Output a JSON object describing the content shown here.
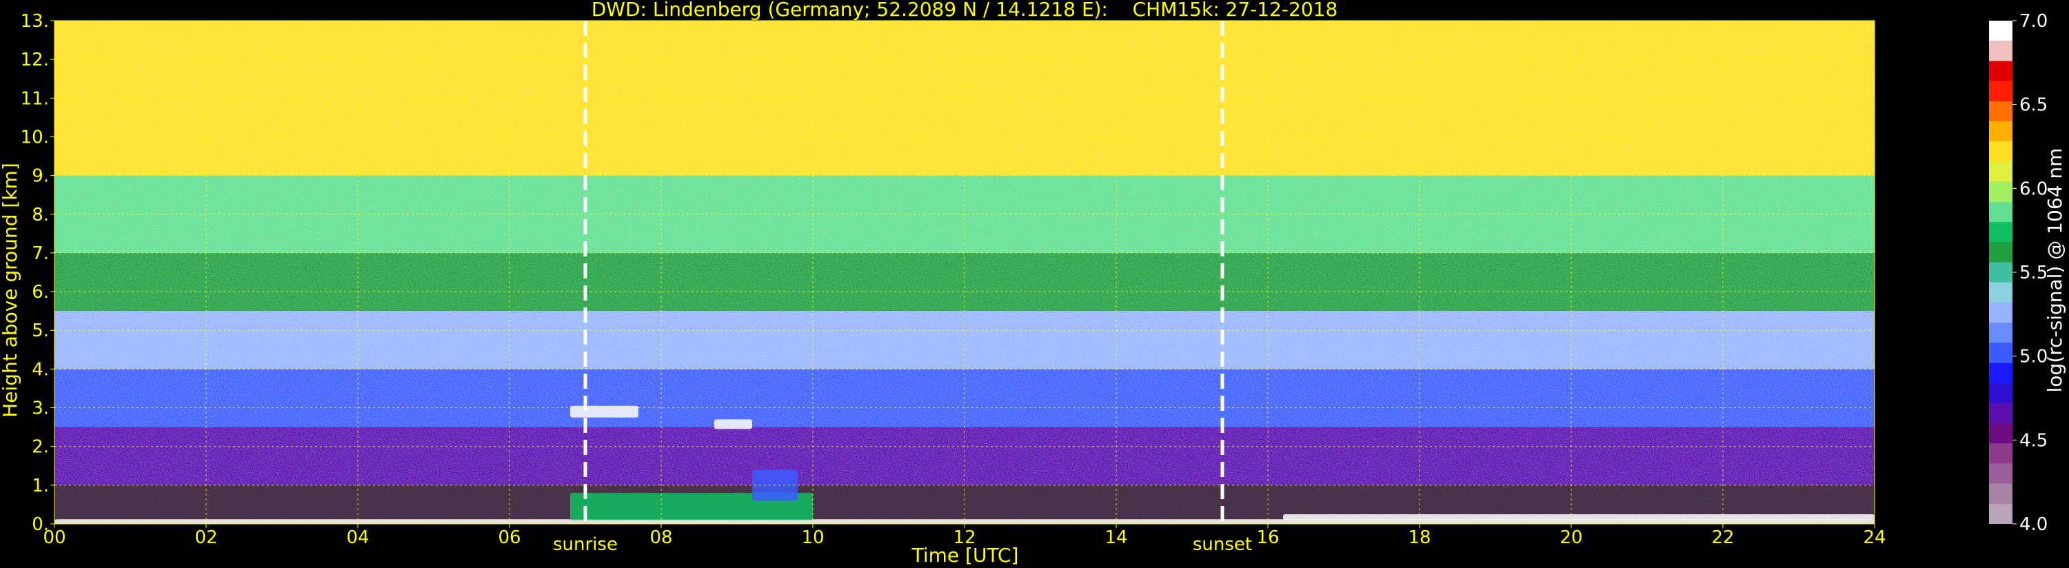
{
  "chart_data": {
    "type": "heatmap",
    "title": "DWD: Lindenberg (Germany; 52.2089 N / 14.1218 E):    CHM15k: 27-12-2018",
    "xlabel": "Time [UTC]",
    "ylabel": "Height above ground [km]",
    "xlim": [
      0,
      24
    ],
    "ylim": [
      0,
      13
    ],
    "x_ticks": [
      "00",
      "02",
      "04",
      "06",
      "08",
      "10",
      "12",
      "14",
      "16",
      "18",
      "20",
      "22",
      "24"
    ],
    "y_ticks": [
      "0.",
      "1.",
      "2.",
      "3.",
      "4.",
      "5.",
      "6.",
      "7.",
      "8.",
      "9.",
      "10.",
      "11.",
      "12.",
      "13."
    ],
    "grid": true,
    "grid_color": "#ffff00",
    "markers": [
      {
        "label": "sunrise",
        "time": 7.0
      },
      {
        "label": "sunset",
        "time": 15.4
      }
    ],
    "colorbar": {
      "label": "log(rc-signal) @ 1064 nm",
      "range": [
        4.0,
        7.0
      ],
      "ticks": [
        "4.0",
        "4.5",
        "5.0",
        "5.5",
        "6.0",
        "6.5",
        "7.0"
      ],
      "colors": [
        "#b8a4b8",
        "#a883a8",
        "#9a5e9a",
        "#8a3c8a",
        "#700a80",
        "#5a10b0",
        "#3010d0",
        "#1a1aff",
        "#3c5cff",
        "#6a8cff",
        "#98b4ff",
        "#8cd0e0",
        "#40c0a0",
        "#20a040",
        "#10c060",
        "#60e090",
        "#a0f060",
        "#e0f040",
        "#ffe020",
        "#ffb000",
        "#ff7000",
        "#ff2000",
        "#e00000",
        "#f0c0c0",
        "#ffffff"
      ]
    },
    "background_field": {
      "description_bands": [
        {
          "h_from": 0.0,
          "h_to": 1.0,
          "value": 4.2
        },
        {
          "h_from": 1.0,
          "h_to": 2.5,
          "value": 4.6
        },
        {
          "h_from": 2.5,
          "h_to": 4.0,
          "value": 5.0
        },
        {
          "h_from": 4.0,
          "h_to": 5.5,
          "value": 5.3
        },
        {
          "h_from": 5.5,
          "h_to": 7.0,
          "value": 5.6
        },
        {
          "h_from": 7.0,
          "h_to": 9.0,
          "value": 5.9
        },
        {
          "h_from": 9.0,
          "h_to": 13.0,
          "value": 6.2
        }
      ]
    },
    "features": [
      {
        "name": "surface-layer",
        "t_from": 0.0,
        "t_to": 24.0,
        "h_from": 0.0,
        "h_to": 0.12,
        "value": 7.0
      },
      {
        "name": "cloud-layer-1",
        "t_from": 6.8,
        "t_to": 7.7,
        "h_from": 2.75,
        "h_to": 3.05,
        "value": 7.0
      },
      {
        "name": "cloud-layer-2",
        "t_from": 8.7,
        "t_to": 9.2,
        "h_from": 2.45,
        "h_to": 2.7,
        "value": 7.0
      },
      {
        "name": "boundary-layer",
        "t_from": 6.8,
        "t_to": 10.0,
        "h_from": 0.1,
        "h_to": 0.8,
        "value": 5.8
      },
      {
        "name": "blue-aerosol",
        "t_from": 9.2,
        "t_to": 9.8,
        "h_from": 0.6,
        "h_to": 1.4,
        "value": 5.0
      },
      {
        "name": "afternoon-bl",
        "t_from": 16.2,
        "t_to": 24.0,
        "h_from": 0.1,
        "h_to": 0.25,
        "value": 7.0
      }
    ]
  }
}
